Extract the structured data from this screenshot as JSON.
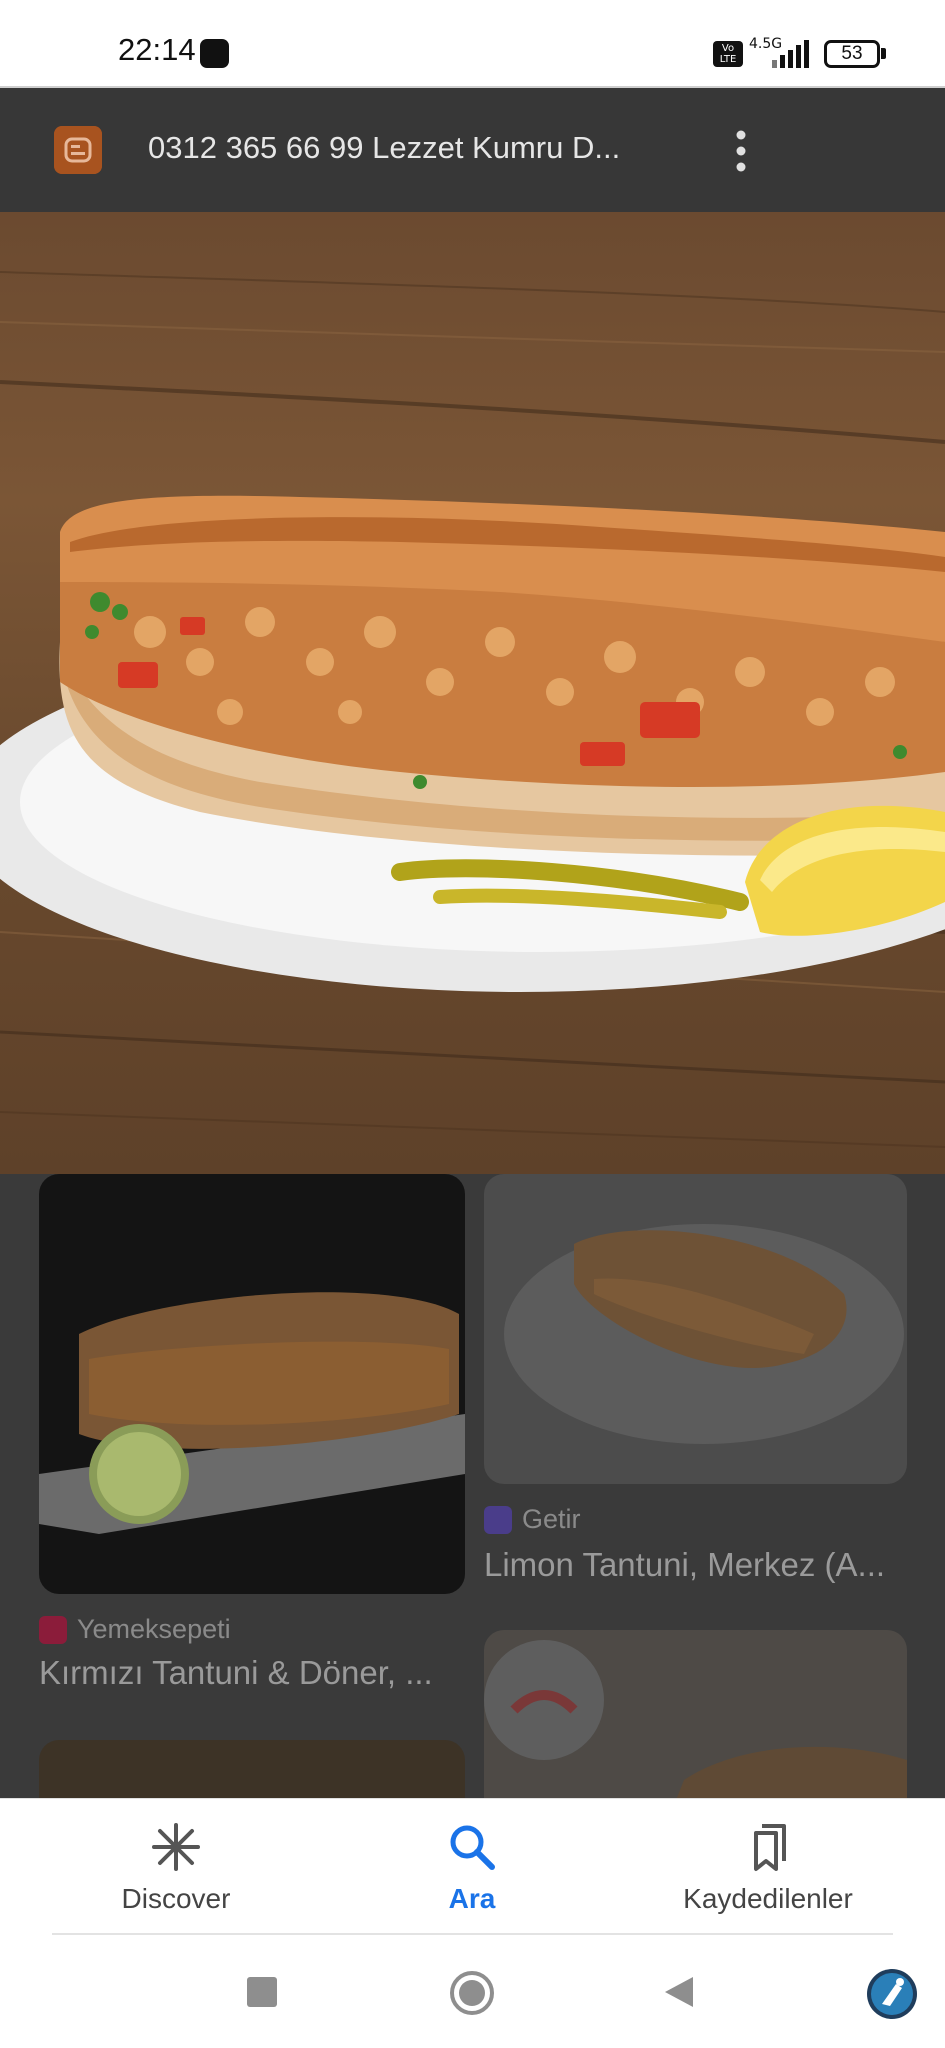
{
  "status_bar": {
    "time": "22:14",
    "volte_label": "Vo LTE",
    "network": "4.5G",
    "battery": "53"
  },
  "source_header": {
    "site_icon": "blogger-icon",
    "title": "0312 365 66 99 Lezzet Kumru D...",
    "menu_icon": "more-vert-icon"
  },
  "hero_image": {
    "subject": "tantuni-sandwich-on-plate"
  },
  "results": [
    {
      "source": "Yemeksepeti",
      "title": "Kırmızı Tantuni & Döner, ...",
      "source_color": "#c2185b"
    },
    {
      "source": "Getir",
      "title": "Limon Tantuni, Merkez (A...",
      "source_color": "#5d3ebc"
    }
  ],
  "bottom_nav": {
    "items": [
      {
        "label": "Discover",
        "icon": "asterisk-icon"
      },
      {
        "label": "Ara",
        "icon": "search-icon"
      },
      {
        "label": "Kaydedilenler",
        "icon": "bookmarks-icon"
      }
    ],
    "active_color": "#1a73e8"
  },
  "system_nav": {
    "items": [
      "recents-button",
      "home-button",
      "back-button",
      "accessibility-button"
    ]
  }
}
